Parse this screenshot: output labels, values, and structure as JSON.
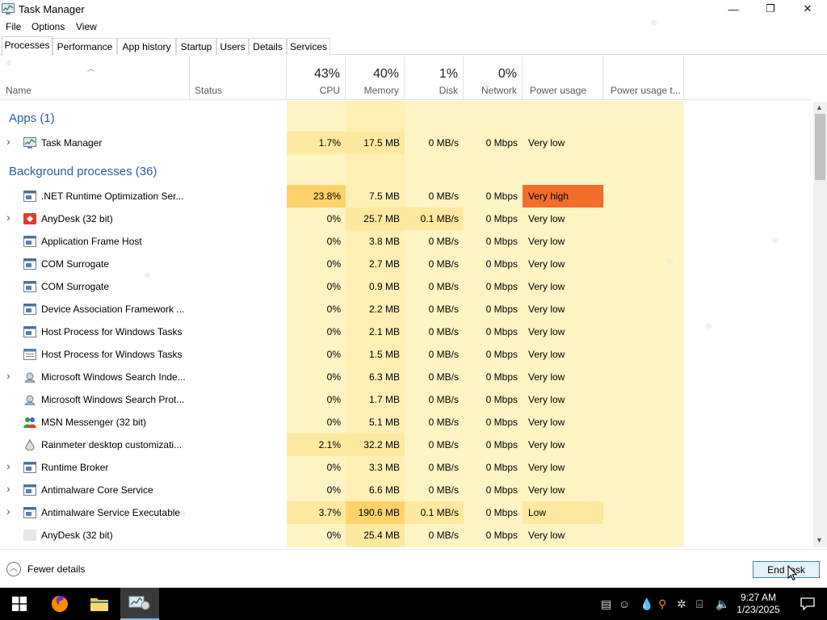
{
  "window": {
    "title": "Task Manager",
    "controls": {
      "minimize": "—",
      "restore": "❐",
      "close": "✕"
    }
  },
  "menu": [
    "File",
    "Options",
    "View"
  ],
  "tabs": [
    "Processes",
    "Performance",
    "App history",
    "Startup",
    "Users",
    "Details",
    "Services"
  ],
  "active_tab": "Processes",
  "columns": {
    "name": "Name",
    "status": "Status",
    "cpu": {
      "pct": "43%",
      "label": "CPU"
    },
    "memory": {
      "pct": "40%",
      "label": "Memory"
    },
    "disk": {
      "pct": "1%",
      "label": "Disk"
    },
    "network": {
      "pct": "0%",
      "label": "Network"
    },
    "power": "Power usage",
    "power_trend": "Power usage t..."
  },
  "groups": {
    "apps": "Apps (1)",
    "background": "Background processes (36)"
  },
  "apps": [
    {
      "name": "Task Manager",
      "cpu": "1.7%",
      "memory": "17.5 MB",
      "disk": "0 MB/s",
      "network": "0 Mbps",
      "power": "Very low",
      "expand": true,
      "icon": "task-manager-icon"
    }
  ],
  "processes": [
    {
      "name": ".NET Runtime Optimization Ser...",
      "cpu": "23.8%",
      "memory": "7.5 MB",
      "disk": "0 MB/s",
      "network": "0 Mbps",
      "power": "Very high",
      "expand": false,
      "icon": "service-window-icon"
    },
    {
      "name": "AnyDesk (32 bit)",
      "cpu": "0%",
      "memory": "25.7 MB",
      "disk": "0.1 MB/s",
      "network": "0 Mbps",
      "power": "Very low",
      "expand": true,
      "icon": "anydesk-icon"
    },
    {
      "name": "Application Frame Host",
      "cpu": "0%",
      "memory": "3.8 MB",
      "disk": "0 MB/s",
      "network": "0 Mbps",
      "power": "Very low",
      "expand": false,
      "icon": "service-window-icon"
    },
    {
      "name": "COM Surrogate",
      "cpu": "0%",
      "memory": "2.7 MB",
      "disk": "0 MB/s",
      "network": "0 Mbps",
      "power": "Very low",
      "expand": false,
      "icon": "service-window-icon"
    },
    {
      "name": "COM Surrogate",
      "cpu": "0%",
      "memory": "0.9 MB",
      "disk": "0 MB/s",
      "network": "0 Mbps",
      "power": "Very low",
      "expand": false,
      "icon": "service-window-icon"
    },
    {
      "name": "Device Association Framework ...",
      "cpu": "0%",
      "memory": "2.2 MB",
      "disk": "0 MB/s",
      "network": "0 Mbps",
      "power": "Very low",
      "expand": false,
      "icon": "service-window-icon"
    },
    {
      "name": "Host Process for Windows Tasks",
      "cpu": "0%",
      "memory": "2.1 MB",
      "disk": "0 MB/s",
      "network": "0 Mbps",
      "power": "Very low",
      "expand": false,
      "icon": "service-window-icon"
    },
    {
      "name": "Host Process for Windows Tasks",
      "cpu": "0%",
      "memory": "1.5 MB",
      "disk": "0 MB/s",
      "network": "0 Mbps",
      "power": "Very low",
      "expand": false,
      "icon": "service-list-icon"
    },
    {
      "name": "Microsoft Windows Search Inde...",
      "cpu": "0%",
      "memory": "6.3 MB",
      "disk": "0 MB/s",
      "network": "0 Mbps",
      "power": "Very low",
      "expand": true,
      "icon": "search-indexer-icon"
    },
    {
      "name": "Microsoft Windows Search Prot...",
      "cpu": "0%",
      "memory": "1.7 MB",
      "disk": "0 MB/s",
      "network": "0 Mbps",
      "power": "Very low",
      "expand": false,
      "icon": "search-indexer-icon"
    },
    {
      "name": "MSN Messenger (32 bit)",
      "cpu": "0%",
      "memory": "5.1 MB",
      "disk": "0 MB/s",
      "network": "0 Mbps",
      "power": "Very low",
      "expand": false,
      "icon": "msn-messenger-icon"
    },
    {
      "name": "Rainmeter desktop customizati...",
      "cpu": "2.1%",
      "memory": "32.2 MB",
      "disk": "0 MB/s",
      "network": "0 Mbps",
      "power": "Very low",
      "expand": false,
      "icon": "rainmeter-icon"
    },
    {
      "name": "Runtime Broker",
      "cpu": "0%",
      "memory": "3.3 MB",
      "disk": "0 MB/s",
      "network": "0 Mbps",
      "power": "Very low",
      "expand": true,
      "icon": "service-window-icon"
    },
    {
      "name": "Antimalware Core Service",
      "cpu": "0%",
      "memory": "6.6 MB",
      "disk": "0 MB/s",
      "network": "0 Mbps",
      "power": "Very low",
      "expand": true,
      "icon": "service-window-icon"
    },
    {
      "name": "Antimalware Service Executable",
      "cpu": "3.7%",
      "memory": "190.6 MB",
      "disk": "0.1 MB/s",
      "network": "0 Mbps",
      "power": "Low",
      "expand": true,
      "icon": "service-window-icon"
    },
    {
      "name": "AnyDesk (32 bit)",
      "cpu": "0%",
      "memory": "25.4 MB",
      "disk": "0 MB/s",
      "network": "0 Mbps",
      "power": "Very low",
      "expand": false,
      "icon": "blank-app-icon"
    }
  ],
  "footer": {
    "fewer_details": "Fewer details",
    "end_task": "End task"
  },
  "taskbar": {
    "time": "9:27 AM",
    "date": "1/23/2025"
  },
  "colors": {
    "accent": "#2a5ea8",
    "heat_light": "#fff4c4",
    "heat_mid": "#ffe9a0",
    "heat_high": "#ffd36a",
    "power_very_high": "#f36d2c",
    "end_task_border": "#3c7fd6"
  }
}
